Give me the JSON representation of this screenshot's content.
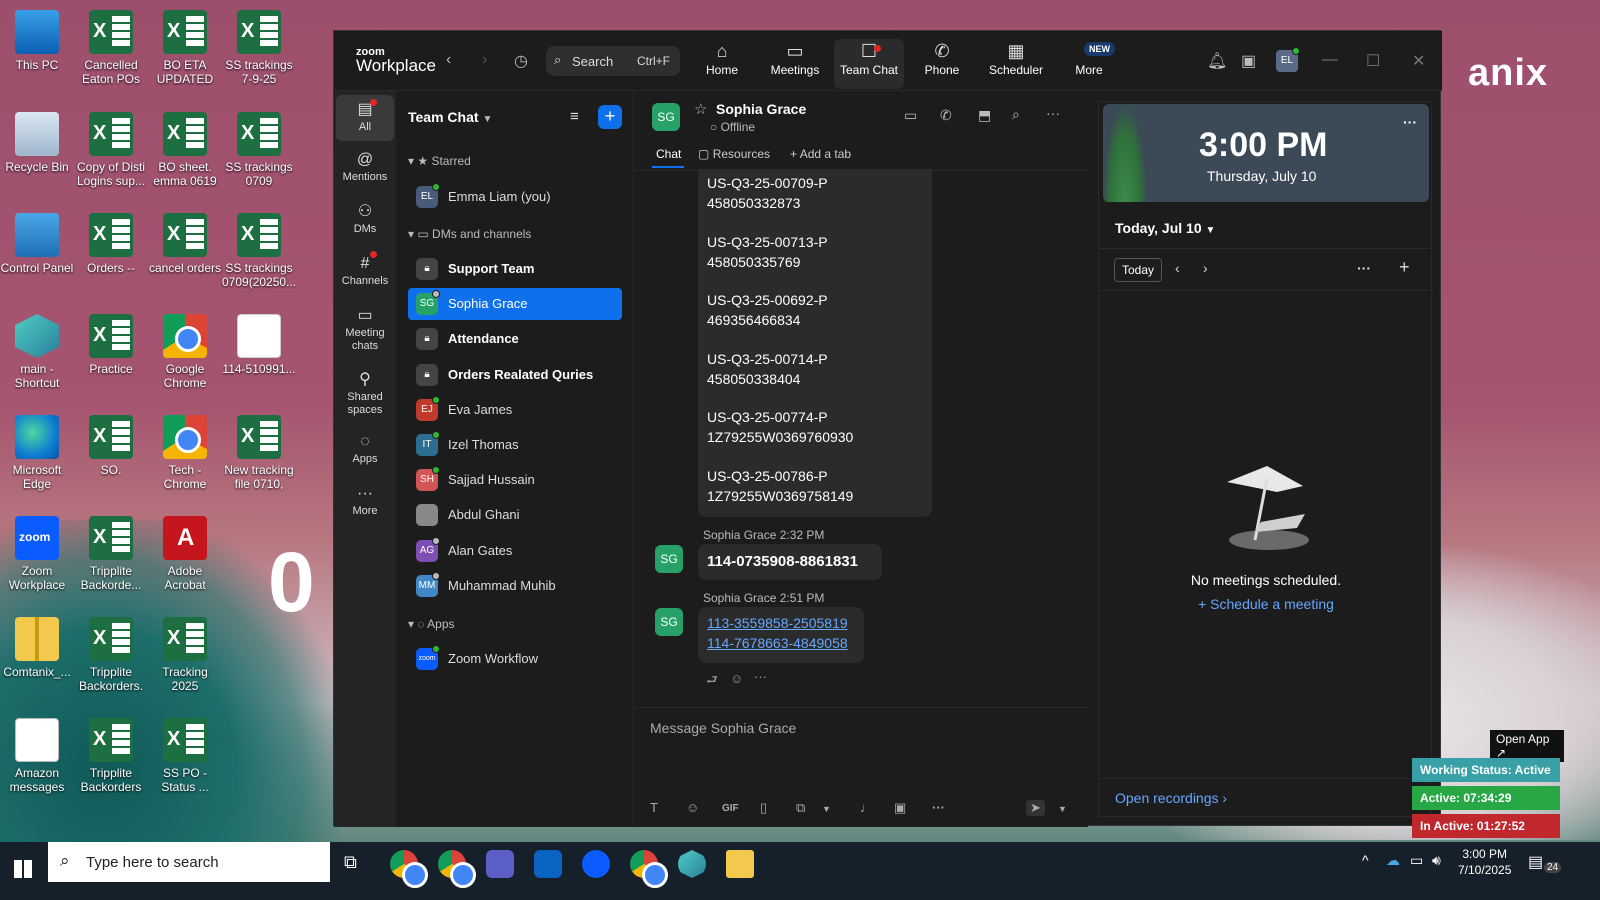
{
  "desktop": {
    "icons": [
      {
        "label": "This PC"
      },
      {
        "label": "Cancelled Eaton POs"
      },
      {
        "label": "BO ETA UPDATED"
      },
      {
        "label": "SS trackings 7-9-25"
      },
      {
        "label": "Recycle Bin"
      },
      {
        "label": "Copy of Disti Logins sup..."
      },
      {
        "label": "BO sheet. emma 0619"
      },
      {
        "label": "SS trackings 0709"
      },
      {
        "label": "Control Panel"
      },
      {
        "label": "Orders --"
      },
      {
        "label": "cancel orders"
      },
      {
        "label": "SS trackings 0709(20250..."
      },
      {
        "label": "main - Shortcut"
      },
      {
        "label": "Practice"
      },
      {
        "label": "Google Chrome"
      },
      {
        "label": "114-510991..."
      },
      {
        "label": "Microsoft Edge"
      },
      {
        "label": "SO."
      },
      {
        "label": "Tech - Chrome"
      },
      {
        "label": "New tracking file 0710,"
      },
      {
        "label": "Zoom Workplace"
      },
      {
        "label": "Tripplite Backorde..."
      },
      {
        "label": "Adobe Acrobat"
      },
      {
        "label": "Comtanix_..."
      },
      {
        "label": "Tripplite Backorders."
      },
      {
        "label": "Tracking 2025"
      },
      {
        "label": "Amazon messages"
      },
      {
        "label": "Tripplite Backorders"
      },
      {
        "label": "SS PO - Status ..."
      }
    ],
    "brand_text": "anix",
    "big_digit": "0"
  },
  "zoom": {
    "logo_top": "zoom",
    "logo_bottom": "Workplace",
    "search_label": "Search",
    "search_shortcut": "Ctrl+F",
    "nav": [
      {
        "label": "Home",
        "icon": "home-icon"
      },
      {
        "label": "Meetings",
        "icon": "video-icon"
      },
      {
        "label": "Team Chat",
        "icon": "chat-icon"
      },
      {
        "label": "Phone",
        "icon": "phone-icon"
      },
      {
        "label": "Scheduler",
        "icon": "calendar-icon"
      },
      {
        "label": "More",
        "icon": "more-icon"
      }
    ],
    "new_badge": "NEW",
    "user_initials": "EL",
    "rail": [
      {
        "label": "All"
      },
      {
        "label": "Mentions"
      },
      {
        "label": "DMs"
      },
      {
        "label": "Channels"
      },
      {
        "label": "Meeting chats"
      },
      {
        "label": "Shared spaces"
      },
      {
        "label": "Apps"
      },
      {
        "label": "More"
      }
    ],
    "list_header": "Team Chat",
    "section_starred": "Starred",
    "section_dms": "DMs and channels",
    "section_apps": "Apps",
    "starred": [
      {
        "initials": "EL",
        "name": "Emma Liam (you)"
      }
    ],
    "dms": [
      {
        "name": "Support Team",
        "type": "channel"
      },
      {
        "initials": "SG",
        "name": "Sophia Grace",
        "type": "dm"
      },
      {
        "name": "Attendance",
        "type": "channel"
      },
      {
        "name": "Orders Realated Quries",
        "type": "channel"
      },
      {
        "initials": "EJ",
        "name": "Eva James",
        "type": "dm"
      },
      {
        "initials": "IT",
        "name": "Izel Thomas",
        "type": "dm"
      },
      {
        "initials": "SH",
        "name": "Sajjad Hussain",
        "type": "dm"
      },
      {
        "initials": "",
        "name": "Abdul Ghani",
        "type": "dm"
      },
      {
        "initials": "AG",
        "name": "Alan Gates",
        "type": "dm"
      },
      {
        "initials": "MM",
        "name": "Muhammad Muhib",
        "type": "dm"
      }
    ],
    "apps": [
      {
        "initials": "zoom",
        "name": "Zoom Workflow"
      }
    ],
    "chat": {
      "initials": "SG",
      "name": "Sophia Grace",
      "status": "Offline",
      "tabs": [
        "Chat",
        "Resources",
        "Add a tab"
      ],
      "bubble_lines": [
        "US-Q3-25-00709-P",
        "458050332873",
        "US-Q3-25-00713-P",
        "458050335769",
        "US-Q3-25-00692-P",
        "469356466834",
        "US-Q3-25-00714-P",
        "458050338404",
        "US-Q3-25-00774-P",
        "1Z79255W0369760930",
        "US-Q3-25-00786-P",
        "1Z79255W0369758149"
      ],
      "msg1_meta": "Sophia Grace 2:32 PM",
      "msg1_text": "114-0735908-8861831",
      "msg2_meta": "Sophia Grace 2:51 PM",
      "msg2_links": [
        "113-3559858-2505819",
        "114-7678663-4849058"
      ],
      "composer_placeholder": "Message Sophia Grace",
      "gif_label": "GIF"
    },
    "calendar": {
      "time": "3:00 PM",
      "date": "Thursday, July 10",
      "today_label": "Today, Jul 10",
      "today_btn": "Today",
      "no_meetings": "No meetings scheduled.",
      "schedule_link": "Schedule a meeting",
      "open_recordings": "Open recordings"
    }
  },
  "widget": {
    "open_app": "Open App",
    "working": "Working Status: Active",
    "active": "Active: 07:34:29",
    "inactive": "In Active: 01:27:52"
  },
  "taskbar": {
    "search_placeholder": "Type here to search",
    "time": "3:00 PM",
    "date": "7/10/2025",
    "notif_count": "24"
  }
}
